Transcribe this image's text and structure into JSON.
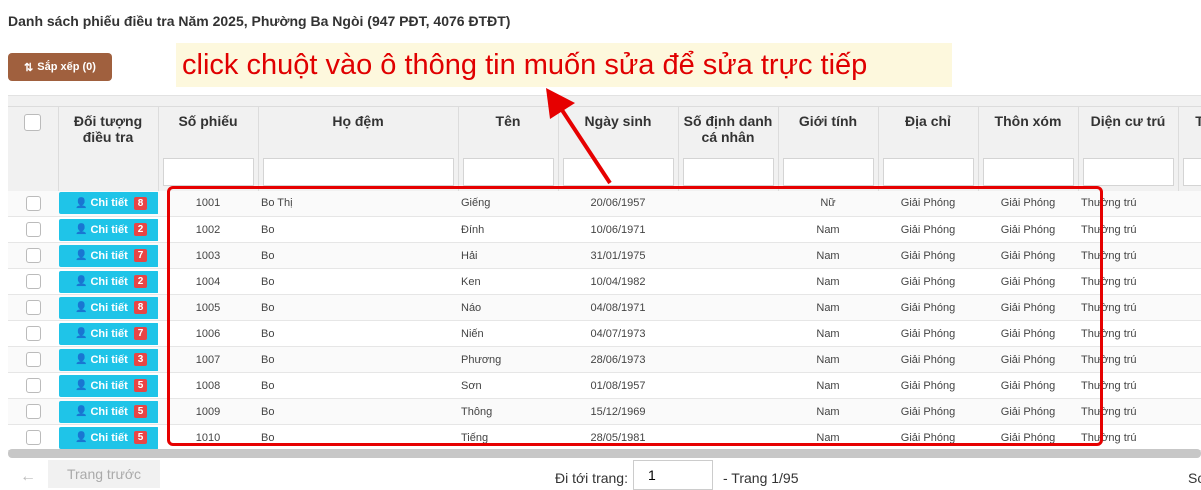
{
  "page": {
    "title": "Danh sách phiếu điều tra Năm 2025, Phường Ba Ngòi (947 PĐT, 4076 ĐTĐT)",
    "sort_label": "Sắp xếp (0)",
    "sort_icon": "sort-icon",
    "annotation": "click chuột vào ô thông tin muốn sửa để sửa trực tiếp",
    "annotation_color": "#e00000"
  },
  "table": {
    "headers": {
      "doi_tuong": "Đối tượng điều tra",
      "so_phieu": "Số phiếu",
      "ho_dem": "Họ đệm",
      "ten": "Tên",
      "ngay_sinh": "Ngày sinh",
      "so_dinh_danh": "Số định danh cá nhân",
      "gioi_tinh": "Giới tính",
      "dia_chi": "Địa chỉ",
      "thon_xom": "Thôn xóm",
      "dien_cu_tru": "Diện cư trú",
      "extra": "T"
    },
    "detail_label": "Chi tiết",
    "detail_color": "#1fc4e8",
    "badge_color": "#e84545",
    "rows": [
      {
        "badge": "8",
        "so_phieu": "1001",
        "ho_dem": "Bo Thị",
        "ten": "Giếng",
        "ngay_sinh": "20/06/1957",
        "so_dinh_danh": "",
        "gioi_tinh": "Nữ",
        "dia_chi": "Giải Phóng",
        "thon_xom": "Giải Phóng",
        "dien_cu_tru": "Thường trú"
      },
      {
        "badge": "2",
        "so_phieu": "1002",
        "ho_dem": "Bo",
        "ten": "Đính",
        "ngay_sinh": "10/06/1971",
        "so_dinh_danh": "",
        "gioi_tinh": "Nam",
        "dia_chi": "Giải Phóng",
        "thon_xom": "Giải Phóng",
        "dien_cu_tru": "Thường trú"
      },
      {
        "badge": "7",
        "so_phieu": "1003",
        "ho_dem": "Bo",
        "ten": "Hải",
        "ngay_sinh": "31/01/1975",
        "so_dinh_danh": "",
        "gioi_tinh": "Nam",
        "dia_chi": "Giải Phóng",
        "thon_xom": "Giải Phóng",
        "dien_cu_tru": "Thường trú"
      },
      {
        "badge": "2",
        "so_phieu": "1004",
        "ho_dem": "Bo",
        "ten": "Ken",
        "ngay_sinh": "10/04/1982",
        "so_dinh_danh": "",
        "gioi_tinh": "Nam",
        "dia_chi": "Giải Phóng",
        "thon_xom": "Giải Phóng",
        "dien_cu_tru": "Thường trú"
      },
      {
        "badge": "8",
        "so_phieu": "1005",
        "ho_dem": "Bo",
        "ten": "Náo",
        "ngay_sinh": "04/08/1971",
        "so_dinh_danh": "",
        "gioi_tinh": "Nam",
        "dia_chi": "Giải Phóng",
        "thon_xom": "Giải Phóng",
        "dien_cu_tru": "Thường trú"
      },
      {
        "badge": "7",
        "so_phieu": "1006",
        "ho_dem": "Bo",
        "ten": "Niến",
        "ngay_sinh": "04/07/1973",
        "so_dinh_danh": "",
        "gioi_tinh": "Nam",
        "dia_chi": "Giải Phóng",
        "thon_xom": "Giải Phóng",
        "dien_cu_tru": "Thường trú"
      },
      {
        "badge": "3",
        "so_phieu": "1007",
        "ho_dem": "Bo",
        "ten": "Phương",
        "ngay_sinh": "28/06/1973",
        "so_dinh_danh": "",
        "gioi_tinh": "Nam",
        "dia_chi": "Giải Phóng",
        "thon_xom": "Giải Phóng",
        "dien_cu_tru": "Thường trú"
      },
      {
        "badge": "5",
        "so_phieu": "1008",
        "ho_dem": "Bo",
        "ten": "Sơn",
        "ngay_sinh": "01/08/1957",
        "so_dinh_danh": "",
        "gioi_tinh": "Nam",
        "dia_chi": "Giải Phóng",
        "thon_xom": "Giải Phóng",
        "dien_cu_tru": "Thường trú"
      },
      {
        "badge": "5",
        "so_phieu": "1009",
        "ho_dem": "Bo",
        "ten": "Thông",
        "ngay_sinh": "15/12/1969",
        "so_dinh_danh": "",
        "gioi_tinh": "Nam",
        "dia_chi": "Giải Phóng",
        "thon_xom": "Giải Phóng",
        "dien_cu_tru": "Thường trú"
      },
      {
        "badge": "5",
        "so_phieu": "1010",
        "ho_dem": "Bo",
        "ten": "Tiếng",
        "ngay_sinh": "28/05/1981",
        "so_dinh_danh": "",
        "gioi_tinh": "Nam",
        "dia_chi": "Giải Phóng",
        "thon_xom": "Giải Phóng",
        "dien_cu_tru": "Thường trú"
      }
    ]
  },
  "pager": {
    "prev_label": "Trang trước",
    "goto_label": "Đi tới trang:",
    "page_value": "1",
    "page_info": "- Trang 1/95",
    "right_text": "Sc"
  }
}
